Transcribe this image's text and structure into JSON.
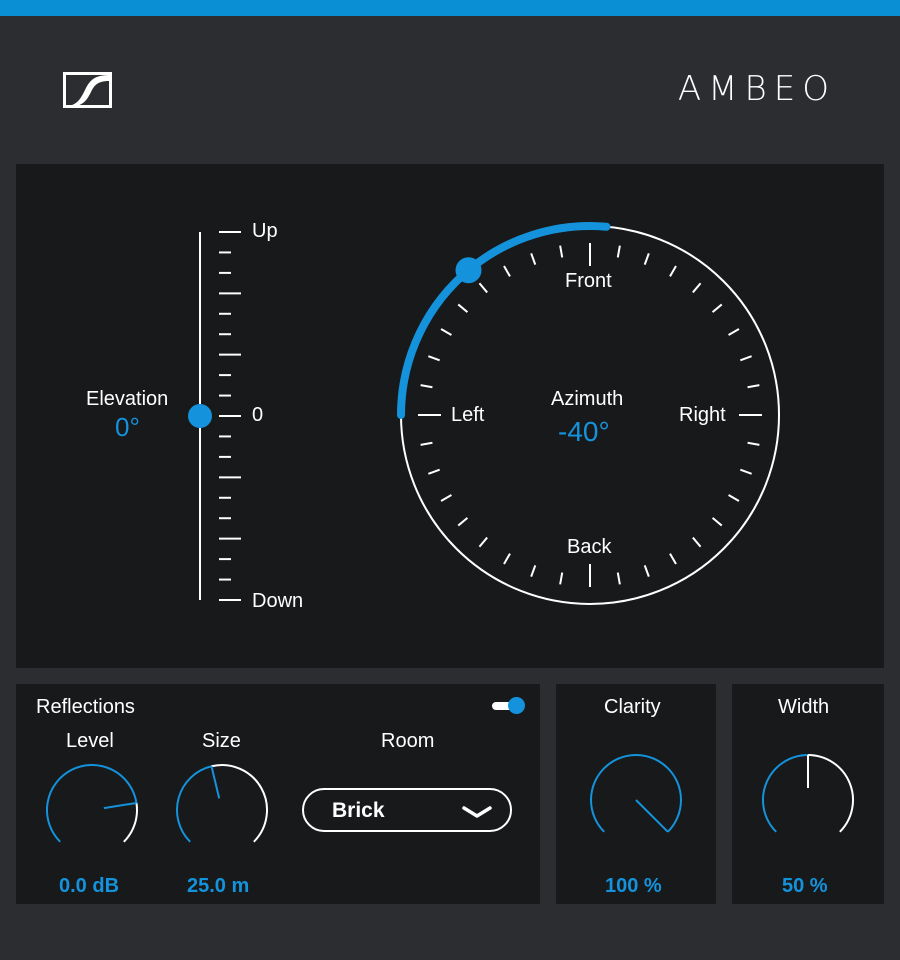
{
  "header": {
    "brand": "AMBEO",
    "logo_icon": "sennheiser-logo-icon"
  },
  "colors": {
    "accent": "#1493dc",
    "topbar": "#0a8fd5",
    "panel": "#18191b",
    "background": "#2b2d31"
  },
  "elevation": {
    "label": "Elevation",
    "value_text": "0°",
    "value": 0,
    "top_label": "Up",
    "middle_label": "0",
    "bottom_label": "Down"
  },
  "azimuth": {
    "label": "Azimuth",
    "value_text": "-40°",
    "value": -40,
    "front_label": "Front",
    "back_label": "Back",
    "left_label": "Left",
    "right_label": "Right"
  },
  "reflections": {
    "title": "Reflections",
    "enabled": true,
    "level": {
      "label": "Level",
      "value_text": "0.0 dB",
      "fraction": 0.8
    },
    "size": {
      "label": "Size",
      "value_text": "25.0 m",
      "fraction": 0.45
    },
    "room": {
      "label": "Room",
      "selected": "Brick"
    }
  },
  "clarity": {
    "label": "Clarity",
    "value_text": "100 %",
    "fraction": 1.0
  },
  "width": {
    "label": "Width",
    "value_text": "50 %",
    "fraction": 0.5
  }
}
